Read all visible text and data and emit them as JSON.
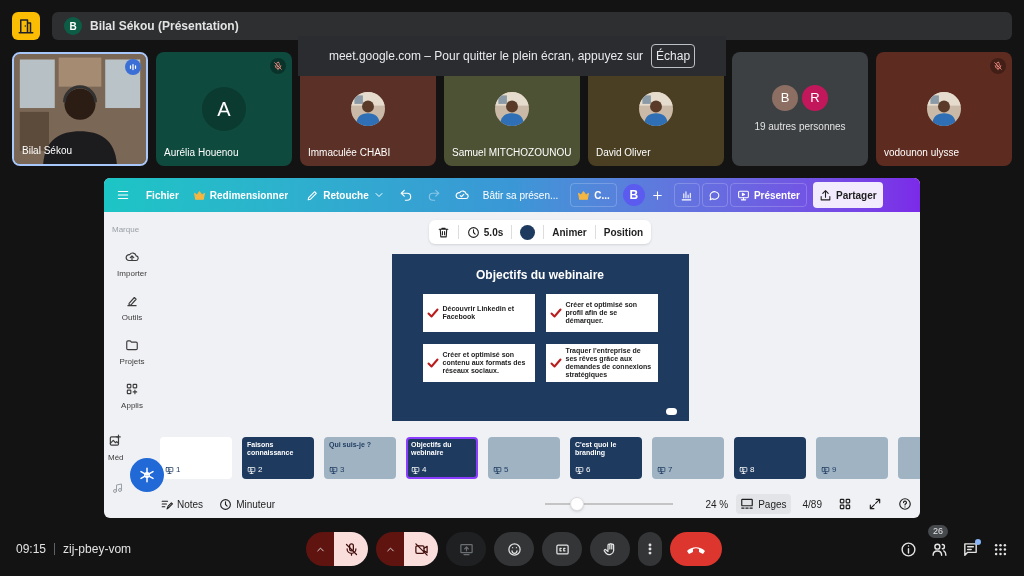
{
  "presenter_bar": {
    "avatar_letter": "B",
    "text": "Bilal Sékou (Présentation)"
  },
  "fullscreen_notice": {
    "text": "meet.google.com – Pour quitter le plein écran, appuyez sur",
    "key": "Échap"
  },
  "tiles": [
    {
      "kind": "video",
      "name": "Bilal Sékou",
      "speaking": true,
      "muted": false,
      "color": "#6b5a4a"
    },
    {
      "kind": "letter",
      "letter": "A",
      "name": "Aurélia Houenou",
      "speaking": false,
      "muted": true,
      "color": "#0e4a3d"
    },
    {
      "name": "Immaculée CHABI",
      "speaking": false,
      "muted": false,
      "color": "#5b3026"
    },
    {
      "name": "Samuel MITCHOZOUNOU",
      "speaking": false,
      "muted": false,
      "color": "#4e5234"
    },
    {
      "name": "David Oliver",
      "speaking": false,
      "muted": false,
      "color": "#4a3f22"
    },
    {
      "kind": "others",
      "letters": [
        {
          "letter": "B",
          "color": "#8d6e63"
        },
        {
          "letter": "R",
          "color": "#c2185b"
        }
      ],
      "text": "19 autres personnes",
      "speaking": false,
      "muted": false,
      "color": "#3c4043"
    },
    {
      "name": "vodounon ulysse",
      "speaking": false,
      "muted": true,
      "color": "#5e2b20"
    }
  ],
  "editor": {
    "toolbar": {
      "file": "Fichier",
      "resize": "Redimensionner",
      "edit": "Retouche",
      "title": "Bâtir sa présen...",
      "team": "C...",
      "avatar": "B",
      "present": "Présenter",
      "share": "Partager",
      "redo_disabled": true
    },
    "context_toolbar": {
      "duration": "5.0s",
      "color": "#1e3a5f",
      "animate": "Animer",
      "position": "Position"
    },
    "sidebar": {
      "heading": "Marque",
      "items": [
        {
          "kind": "upload",
          "label": "Importer"
        },
        {
          "kind": "tools",
          "label": "Outils"
        },
        {
          "kind": "folder",
          "label": "Projets"
        },
        {
          "kind": "apps",
          "label": "Applis"
        },
        {
          "kind": "media",
          "label": "Méd"
        }
      ]
    },
    "slide": {
      "title": "Objectifs du webinaire",
      "items": [
        "Découvrir Linkedin et Facebook",
        "Créer et optimisé son profil afin de se démarquer.",
        "Créer et optimisé son contenu aux formats des réseaux sociaux.",
        "Traquer l'entreprise de ses rêves grâce aux demandes de connexions stratégiques"
      ]
    },
    "thumbnails": [
      {
        "number": "1",
        "kind": "light",
        "selected": false
      },
      {
        "number": "2",
        "kind": "navy",
        "title": "Faisons connaissance",
        "selected": false
      },
      {
        "number": "3",
        "kind": "slate",
        "title": "Qui suis-je ?",
        "selected": false
      },
      {
        "number": "4",
        "kind": "navy",
        "title": "Objectifs du webinaire",
        "selected": true
      },
      {
        "number": "5",
        "kind": "slate",
        "selected": false
      },
      {
        "number": "6",
        "kind": "navy",
        "title": "C'est quoi le branding",
        "selected": false
      },
      {
        "number": "7",
        "kind": "slate",
        "selected": false
      },
      {
        "number": "8",
        "kind": "navy",
        "selected": false
      },
      {
        "number": "9",
        "kind": "slate",
        "selected": false
      },
      {
        "kind": "slate",
        "selected": false
      }
    ],
    "footer": {
      "notes": "Notes",
      "timer": "Minuteur",
      "zoom": {
        "level": 0.25
      },
      "zoom_text": "24 %",
      "pages": "Pages",
      "pages_selected": true,
      "page_count": "4/89"
    }
  },
  "meeting_bar": {
    "time": "09:15",
    "code": "zij-pbey-vom",
    "mic_off": true,
    "camera_off": true,
    "present_disabled": true,
    "participants": "26",
    "chat_unread": true
  }
}
